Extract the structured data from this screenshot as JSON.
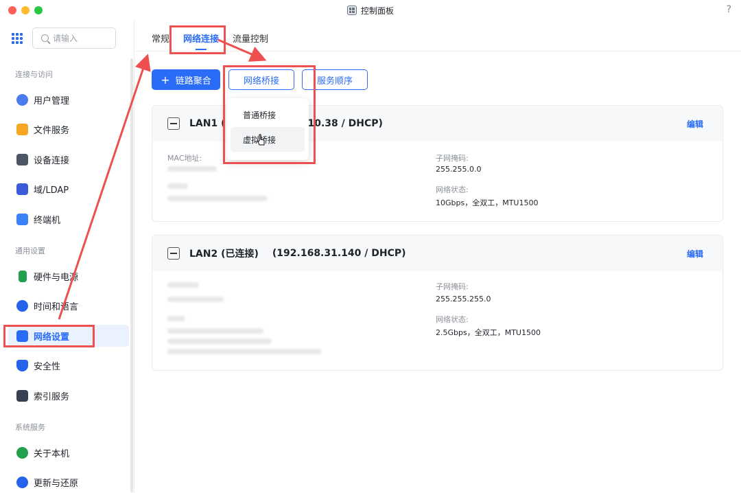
{
  "window": {
    "title": "控制面板",
    "help": "?"
  },
  "sidebar": {
    "search_placeholder": "请输入",
    "sections": [
      {
        "title": "连接与访问"
      },
      {
        "title": "通用设置"
      },
      {
        "title": "系统服务"
      }
    ],
    "items": [
      {
        "label": "用户管理",
        "icon": "user-icon",
        "color": "#4a7cf0"
      },
      {
        "label": "文件服务",
        "icon": "folder-icon",
        "color": "#f5a623"
      },
      {
        "label": "设备连接",
        "icon": "device-icon",
        "color": "#4b5563"
      },
      {
        "label": "域/LDAP",
        "icon": "domain-icon",
        "color": "#3b5bdb"
      },
      {
        "label": "终端机",
        "icon": "terminal-icon",
        "color": "#3b82f6"
      },
      {
        "label": "硬件与电源",
        "icon": "battery-icon",
        "color": "#22a04b"
      },
      {
        "label": "时间和语言",
        "icon": "globe-icon",
        "color": "#2563eb"
      },
      {
        "label": "网络设置",
        "icon": "network-icon",
        "color": "#2a6cf6"
      },
      {
        "label": "安全性",
        "icon": "shield-icon",
        "color": "#2563eb"
      },
      {
        "label": "索引服务",
        "icon": "index-icon",
        "color": "#374151"
      },
      {
        "label": "关于本机",
        "icon": "info-icon",
        "color": "#22a04b"
      },
      {
        "label": "更新与还原",
        "icon": "refresh-icon",
        "color": "#2563eb"
      }
    ],
    "active_item": "网络设置"
  },
  "tabs": [
    {
      "label": "常规"
    },
    {
      "label": "网络连接"
    },
    {
      "label": "流量控制"
    }
  ],
  "active_tab": "网络连接",
  "toolbar": {
    "link_aggregation": "链路聚合",
    "plus": "+",
    "network_bridge": "网络桥接",
    "service_order": "服务顺序"
  },
  "bridge_menu": {
    "items": [
      {
        "label": "普通桥接"
      },
      {
        "label": "虚拟桥接"
      }
    ],
    "hovered": "虚拟桥接"
  },
  "lan1": {
    "name": "LAN1 (",
    "addr": "10.38 / DHCP)",
    "edit": "编辑",
    "mac_label": "MAC地址:",
    "subnet_label": "子网掩码:",
    "subnet_value": "255.255.0.0",
    "status_label": "网络状态:",
    "status_value": "10Gbps，全双工，MTU1500"
  },
  "lan2": {
    "name": "LAN2 (已连接)",
    "addr": "(192.168.31.140 / DHCP)",
    "edit": "编辑",
    "subnet_label": "子网掩码:",
    "subnet_value": "255.255.255.0",
    "status_label": "网络状态:",
    "status_value": "2.5Gbps，全双工，MTU1500"
  },
  "colors": {
    "accent": "#2a6cf6",
    "annotation": "#ee4f4f"
  }
}
